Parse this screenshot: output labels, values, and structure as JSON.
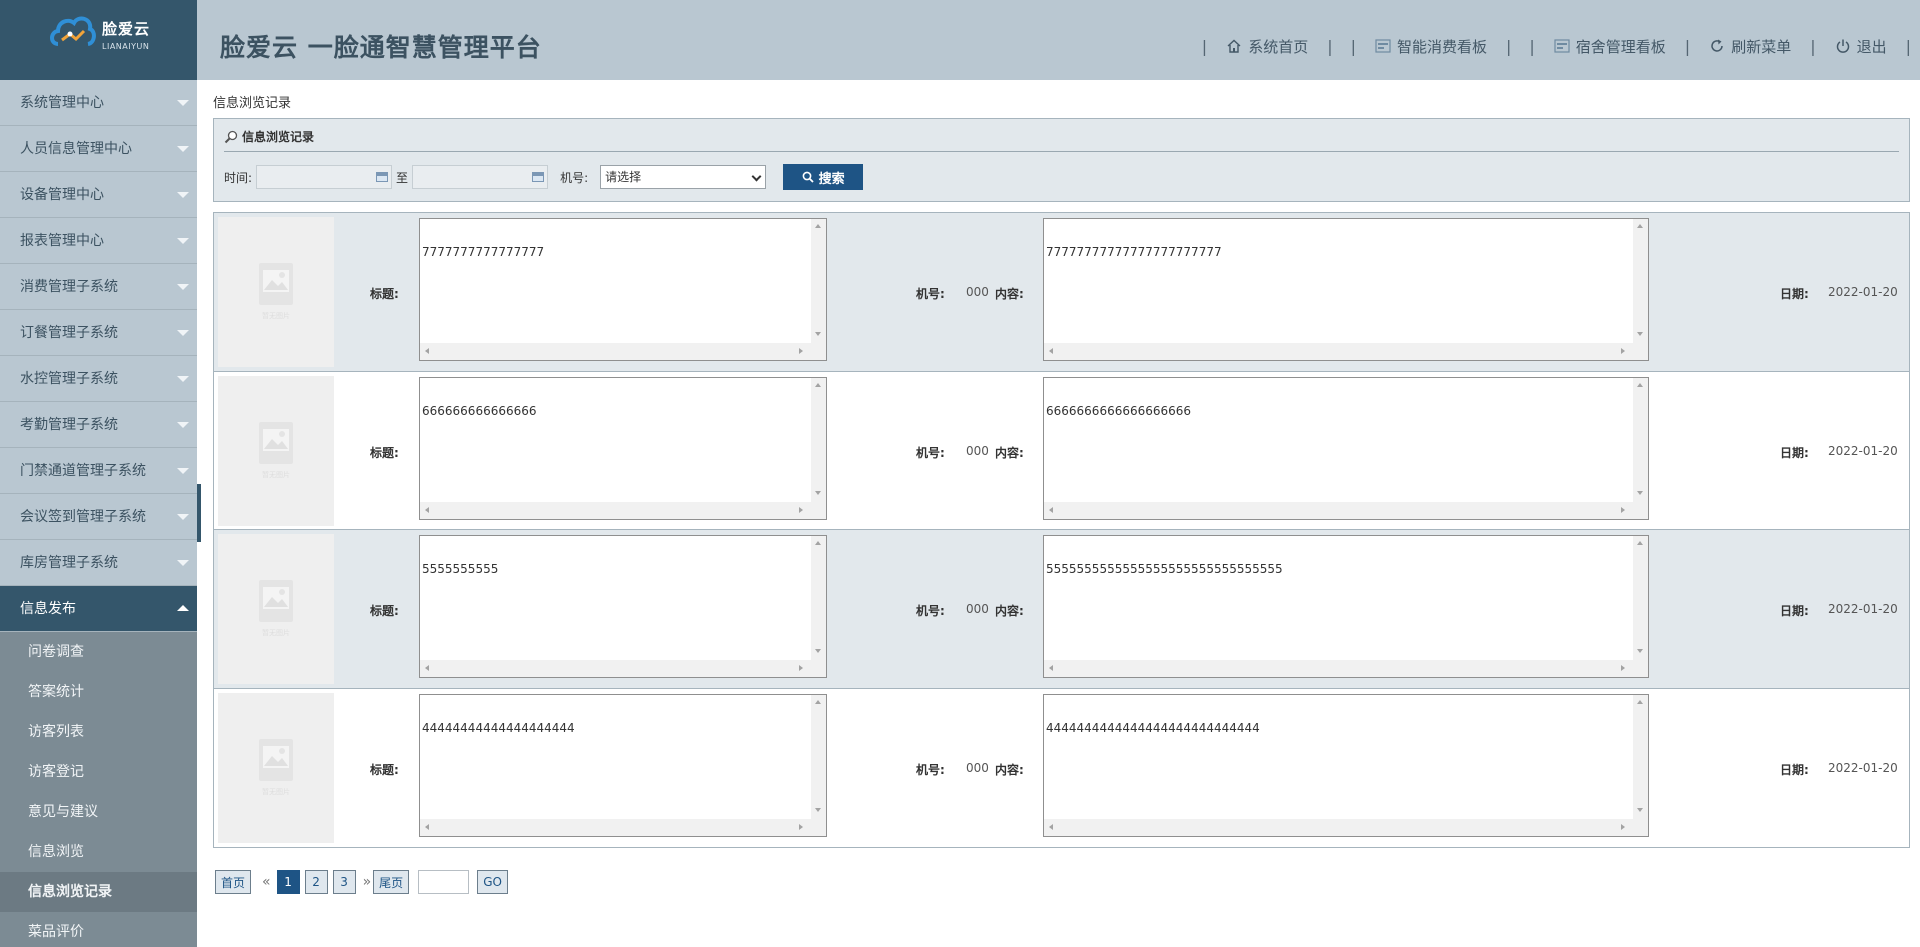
{
  "brand": {
    "name": "脸爱云",
    "name_en": "LIANAIYUN",
    "title": "脸爱云 一脸通智慧管理平台",
    "accent": "#34566b"
  },
  "topnav": [
    {
      "label": "系统首页",
      "icon": "home-icon"
    },
    {
      "label": "智能消费看板",
      "icon": "dashboard-icon"
    },
    {
      "label": "宿舍管理看板",
      "icon": "dashboard-icon"
    },
    {
      "label": "刷新菜单",
      "icon": "refresh-icon"
    },
    {
      "label": "退出",
      "icon": "power-icon"
    }
  ],
  "sidebar": {
    "menus": [
      "系统管理中心",
      "人员信息管理中心",
      "设备管理中心",
      "报表管理中心",
      "消费管理子系统",
      "订餐管理子系统",
      "水控管理子系统",
      "考勤管理子系统",
      "门禁通道管理子系统",
      "会议签到管理子系统",
      "库房管理子系统"
    ],
    "open_menu": "信息发布",
    "sub_items": [
      "问卷调查",
      "答案统计",
      "访客列表",
      "访客登记",
      "意见与建议",
      "信息浏览",
      "信息浏览记录",
      "菜品评价"
    ],
    "active_sub": "信息浏览记录"
  },
  "breadcrumb": "信息浏览记录",
  "search": {
    "panel_title": "信息浏览记录",
    "time_label": "时间:",
    "to_label": "至",
    "machine_label": "机号:",
    "machine_select": "请选择",
    "search_button": "搜索"
  },
  "record_labels": {
    "title": "标题:",
    "machine": "机号:",
    "content": "内容:",
    "date": "日期:",
    "placeholder": "暂无图片"
  },
  "records": [
    {
      "title": "7777777777777777",
      "machine": "000",
      "content": "77777777777777777777777",
      "date": "2022-01-20"
    },
    {
      "title": "666666666666666",
      "machine": "000",
      "content": "6666666666666666666",
      "date": "2022-01-20"
    },
    {
      "title": "5555555555",
      "machine": "000",
      "content": "5555555555555555555555555555555",
      "date": "2022-01-20"
    },
    {
      "title": "44444444444444444444",
      "machine": "000",
      "content": "4444444444444444444444444444",
      "date": "2022-01-20"
    }
  ],
  "pager": {
    "first": "首页",
    "prev": "«",
    "pages": [
      "1",
      "2",
      "3"
    ],
    "current": "1",
    "next": "»",
    "last": "尾页",
    "go": "GO"
  }
}
